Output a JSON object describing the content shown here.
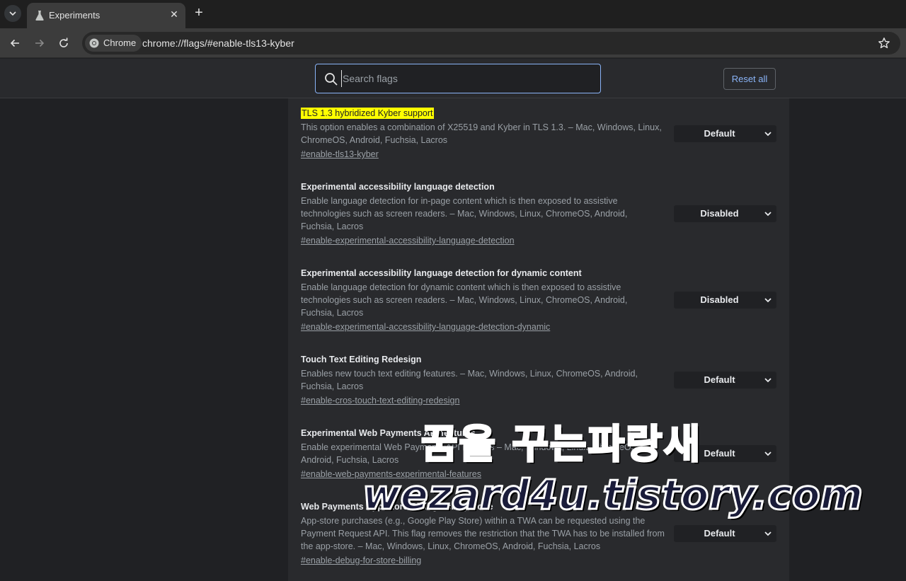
{
  "tab": {
    "title": "Experiments"
  },
  "omnibox": {
    "chip_label": "Chrome",
    "url": "chrome://flags/#enable-tls13-kyber"
  },
  "search": {
    "placeholder": "Search flags"
  },
  "reset_label": "Reset all",
  "flags": [
    {
      "title": "TLS 1.3 hybridized Kyber support",
      "description": "This option enables a combination of X25519 and Kyber in TLS 1.3. – Mac, Windows, Linux, ChromeOS, Android, Fuchsia, Lacros",
      "link": "#enable-tls13-kyber",
      "value": "Default",
      "highlighted": true
    },
    {
      "title": "Experimental accessibility language detection",
      "description": "Enable language detection for in-page content which is then exposed to assistive technologies such as screen readers. – Mac, Windows, Linux, ChromeOS, Android, Fuchsia, Lacros",
      "link": "#enable-experimental-accessibility-language-detection",
      "value": "Disabled"
    },
    {
      "title": "Experimental accessibility language detection for dynamic content",
      "description": "Enable language detection for dynamic content which is then exposed to assistive technologies such as screen readers. – Mac, Windows, Linux, ChromeOS, Android, Fuchsia, Lacros",
      "link": "#enable-experimental-accessibility-language-detection-dynamic",
      "value": "Disabled"
    },
    {
      "title": "Touch Text Editing Redesign",
      "description": "Enables new touch text editing features. – Mac, Windows, Linux, ChromeOS, Android, Fuchsia, Lacros",
      "link": "#enable-cros-touch-text-editing-redesign",
      "value": "Default"
    },
    {
      "title": "Experimental Web Payments API features",
      "description": "Enable experimental Web Payments API features – Mac, Windows, Linux, ChromeOS, Android, Fuchsia, Lacros",
      "link": "#enable-web-payments-experimental-features",
      "value": "Default"
    },
    {
      "title": "Web Payments App Store Billing Debug Mode",
      "description": "App-store purchases (e.g., Google Play Store) within a TWA can be requested using the Payment Request API. This flag removes the restriction that the TWA has to be installed from the app-store. – Mac, Windows, Linux, ChromeOS, Android, Fuchsia, Lacros",
      "link": "#enable-debug-for-store-billing",
      "value": "Default"
    }
  ],
  "watermark": {
    "line1": "꿈을 꾸는파랑새",
    "line2": "wezard4u.tistory.com"
  },
  "colors": {
    "accent": "#8ab4f8",
    "highlight": "#ffff00",
    "background": "#202124",
    "panel": "#292a2d"
  }
}
